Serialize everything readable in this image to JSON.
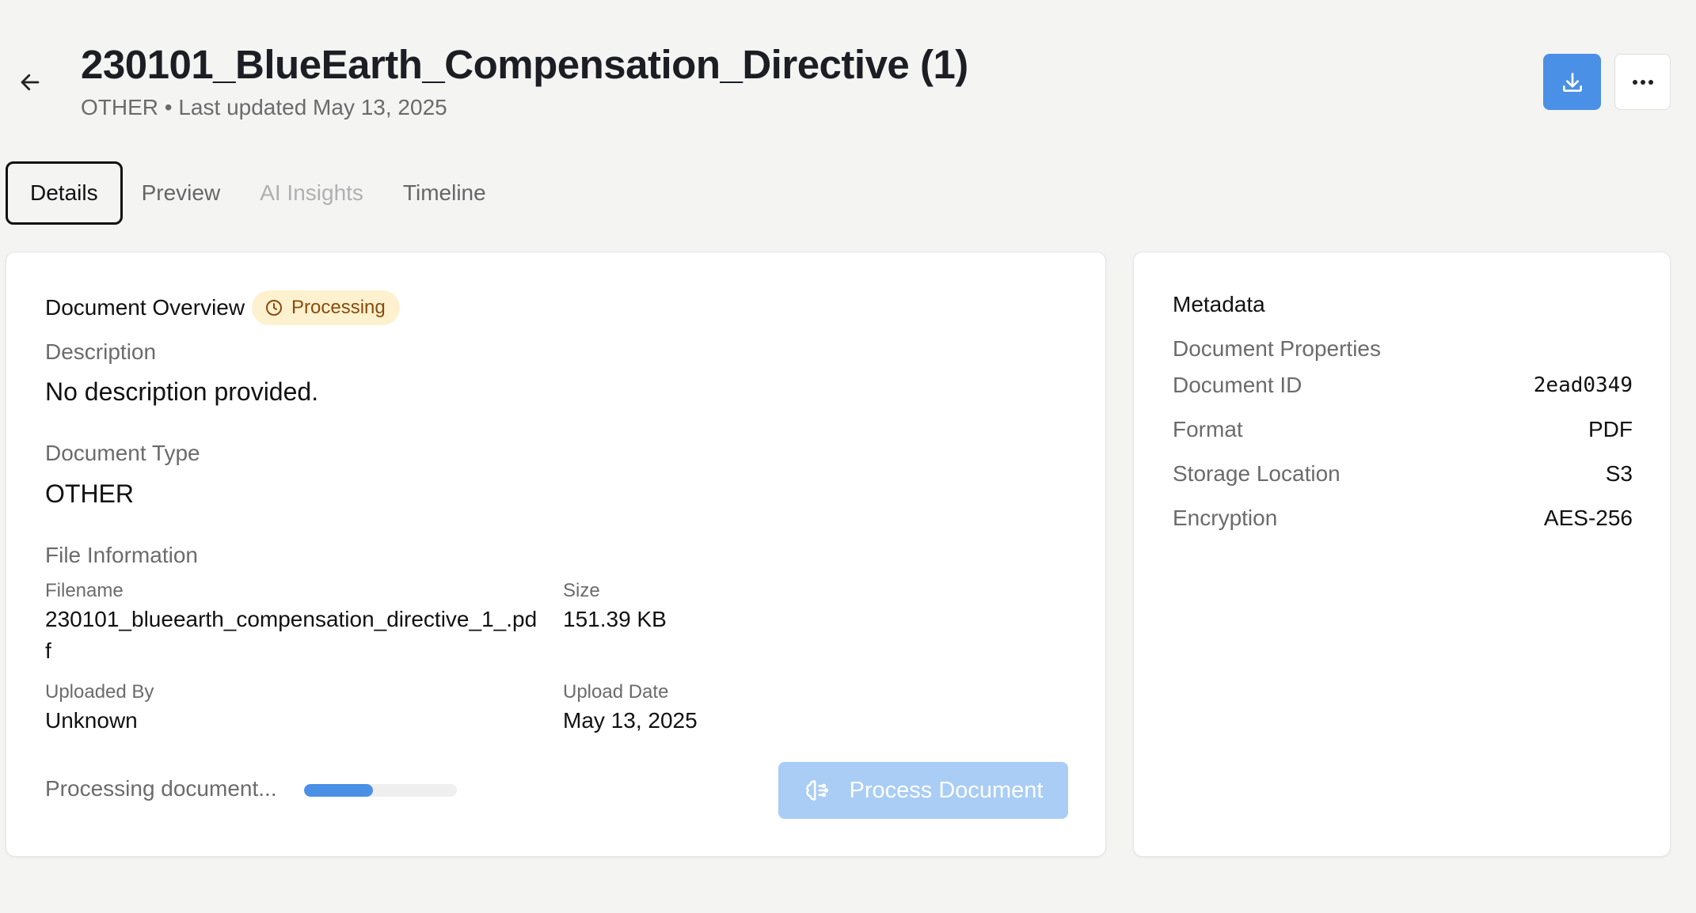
{
  "header": {
    "title": "230101_BlueEarth_Compensation_Directive (1)",
    "subtitle": "OTHER • Last updated May 13, 2025",
    "back_icon": "arrow-left-icon",
    "download_icon": "download-icon",
    "more_icon": "more-horizontal-icon",
    "accent_color": "#4a90e6"
  },
  "tabs": [
    {
      "label": "Details",
      "state": "active"
    },
    {
      "label": "Preview",
      "state": "normal"
    },
    {
      "label": "AI Insights",
      "state": "disabled"
    },
    {
      "label": "Timeline",
      "state": "normal"
    }
  ],
  "overview": {
    "title": "Document Overview",
    "status_badge": "Processing",
    "status_icon": "clock-icon",
    "description_label": "Description",
    "description_value": "No description provided.",
    "type_label": "Document Type",
    "type_value": "OTHER",
    "file_info_label": "File Information",
    "filename_label": "Filename",
    "filename_value_line1": "230101_blueearth_compensation_directive_1_.pd",
    "filename_value_line2": "f",
    "size_label": "Size",
    "size_value": "151.39 KB",
    "uploaded_by_label": "Uploaded By",
    "uploaded_by_value": "Unknown",
    "upload_date_label": "Upload Date",
    "upload_date_value": "May 13, 2025",
    "progress_label": "Processing document...",
    "progress_fraction": 0.45,
    "process_button_label": "Process Document",
    "process_button_icon": "brain-icon"
  },
  "metadata": {
    "title": "Metadata",
    "section_label": "Document Properties",
    "rows": [
      {
        "key": "Document ID",
        "value": "2ead0349"
      },
      {
        "key": "Format",
        "value": "PDF"
      },
      {
        "key": "Storage Location",
        "value": "S3"
      },
      {
        "key": "Encryption",
        "value": "AES-256"
      }
    ]
  }
}
